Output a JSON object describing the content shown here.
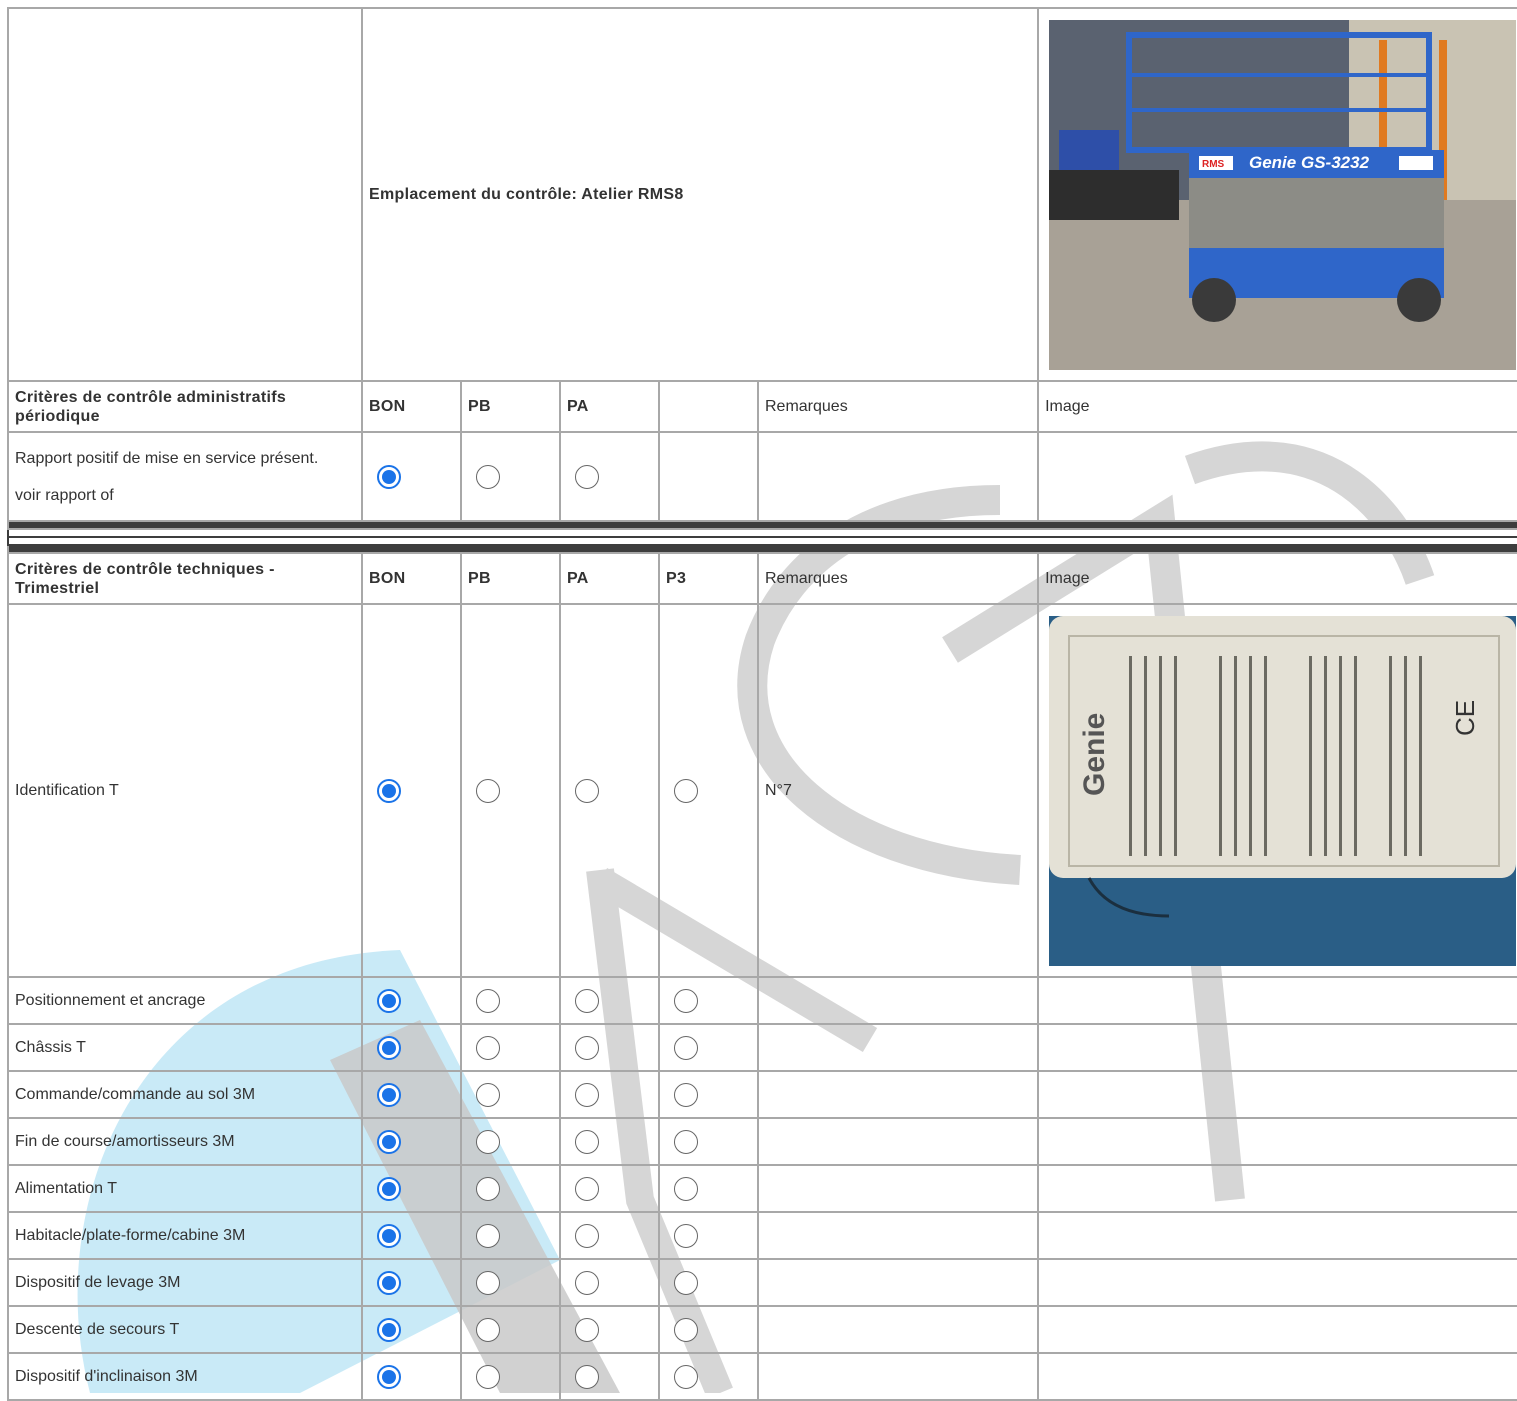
{
  "location": "Emplacement du contrôle: Atelier RMS8",
  "admin": {
    "heading": "Critères de contrôle administratifs périodique",
    "cols": {
      "bon": "BON",
      "pb": "PB",
      "pa": "PA",
      "remarks": "Remarques",
      "image": "Image"
    },
    "row": {
      "label_line1": "Rapport positif de mise en service présent.",
      "label_line2": "voir rapport of",
      "selected": "BON"
    }
  },
  "tech": {
    "heading": "Critères de contrôle techniques - Trimestriel",
    "cols": {
      "bon": "BON",
      "pb": "PB",
      "pa": "PA",
      "p3": "P3",
      "remarks": "Remarques",
      "image": "Image"
    },
    "rows": [
      {
        "label": "Identification T",
        "remark": "N°7",
        "selected": "BON"
      },
      {
        "label": "Positionnement et ancrage",
        "remark": "",
        "selected": "BON"
      },
      {
        "label": "Châssis T",
        "remark": "",
        "selected": "BON"
      },
      {
        "label": "Commande/commande au sol 3M",
        "remark": "",
        "selected": "BON"
      },
      {
        "label": "Fin de course/amortisseurs 3M",
        "remark": "",
        "selected": "BON"
      },
      {
        "label": "Alimentation T",
        "remark": "",
        "selected": "BON"
      },
      {
        "label": "Habitacle/plate-forme/cabine 3M",
        "remark": "",
        "selected": "BON"
      },
      {
        "label": "Dispositif de levage 3M",
        "remark": "",
        "selected": "BON"
      },
      {
        "label": "Descente de secours T",
        "remark": "",
        "selected": "BON"
      },
      {
        "label": "Dispositif d'inclinaison 3M",
        "remark": "",
        "selected": "BON"
      }
    ]
  },
  "photos": {
    "machine": {
      "plate_brand": "Genie",
      "plate_model": "GS-3232",
      "badge": "RMS"
    },
    "label_plate": {
      "brand": "Genie",
      "mark": "CE"
    }
  },
  "colors": {
    "accent": "#1a73e8",
    "border": "#a8a8a8",
    "separator": "#3d3d3d"
  }
}
